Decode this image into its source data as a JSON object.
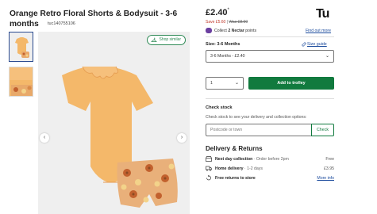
{
  "product": {
    "title": "Orange Retro Floral Shorts & Bodysuit - 3-6 months",
    "sku": "tuc140755106"
  },
  "gallery": {
    "shop_similar": "Shop similar",
    "prev_arrow": "‹",
    "next_arrow": "›"
  },
  "pricing": {
    "price": "£2.40",
    "price_star": "*",
    "save": "Save £5.60",
    "separator": " | ",
    "was": "Was £8.00"
  },
  "brand": {
    "logo_text": "Tu"
  },
  "nectar": {
    "prefix": "Collect ",
    "points": "2 Nectar",
    "suffix": " points",
    "find_more": "Find out more"
  },
  "size": {
    "label": "Size: 3-6 Months",
    "guide": "Size guide",
    "selected": "3-6 Months - £2.40"
  },
  "purchase": {
    "quantity": "1",
    "add_to_trolley": "Add to trolley"
  },
  "stock": {
    "heading": "Check stock",
    "description": "Check stock to see your delivery and collection options:",
    "placeholder": "Postcode or town",
    "button": "Check"
  },
  "delivery": {
    "heading": "Delivery & Returns",
    "rows": [
      {
        "label": "Next day collection",
        "sub": " · Order before 2pm",
        "value": "Free",
        "icon": "store-icon"
      },
      {
        "label": "Home delivery",
        "sub": " · 1-2 days",
        "value": "£3.95",
        "icon": "van-icon"
      },
      {
        "label": "Free returns to store",
        "sub": "",
        "value": "More info",
        "icon": "returns-icon"
      }
    ]
  },
  "colors": {
    "green": "#117a3e",
    "link_blue": "#1a4a9c",
    "sale_red": "#c0392b",
    "nectar_purple": "#6b3fa0",
    "garment_orange": "#f4b86a"
  }
}
